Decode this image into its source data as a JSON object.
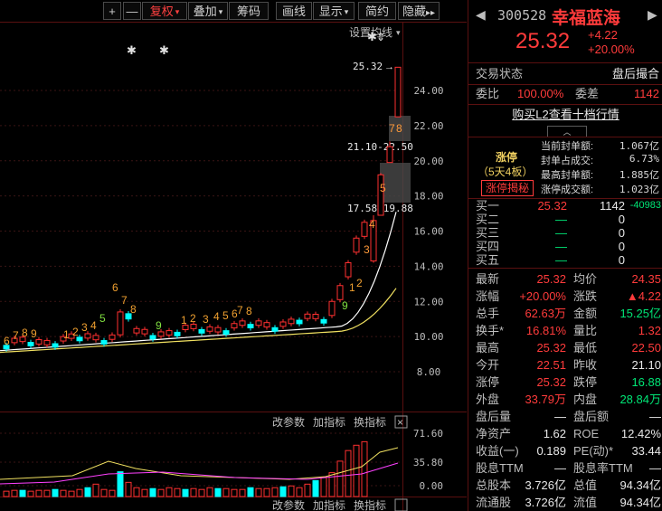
{
  "toolbar": {
    "plus": "+",
    "minus": "—",
    "buttons": [
      {
        "label": "复权",
        "active": true,
        "caret": true
      },
      {
        "label": "叠加",
        "active": false,
        "caret": true
      },
      {
        "label": "筹码",
        "active": false,
        "caret": false
      },
      {
        "label": "画线",
        "active": false,
        "caret": false
      },
      {
        "label": "显示",
        "active": false,
        "caret": true
      },
      {
        "label": "简约",
        "active": false,
        "caret": false
      },
      {
        "label": "隐藏",
        "active": false,
        "caret": false
      }
    ],
    "expand_glyph": "▸▸"
  },
  "chart": {
    "ma_settings": "设置均线",
    "price_axis": [
      "24.00",
      "22.00",
      "20.00",
      "18.00",
      "16.00",
      "14.00",
      "12.00",
      "10.00",
      "8.00"
    ],
    "annotations": {
      "high": "25.32",
      "gap1": "21.10-22.50",
      "gap2": "17.58-19.88"
    },
    "nine_turn_top": [
      "6",
      "7",
      "8",
      "9",
      "1",
      "2",
      "3",
      "4",
      "5",
      "6",
      "7",
      "8",
      "9",
      "1",
      "2",
      "3",
      "4",
      "5",
      "6",
      "7",
      "8",
      "9",
      "1",
      "2",
      "3",
      "4",
      "5",
      "7",
      "8"
    ],
    "volume_axis": [
      "71.60",
      "35.80",
      "0.00"
    ],
    "sub_panel_actions": [
      "改参数",
      "加指标",
      "换指标"
    ],
    "close_icon": "×",
    "colors": {
      "up": "#ff3030",
      "down": "#00ffff",
      "ma_white": "#ffffff",
      "ma_yellow": "#f0e060",
      "ma_pink": "#ff40ff"
    }
  },
  "quote": {
    "code": "300528",
    "name": "幸福蓝海",
    "price": "25.32",
    "change": "+4.22",
    "change_pct": "+20.00%",
    "trade_status_label": "交易状态",
    "trade_status_value": "盘后撮合",
    "weibi_label": "委比",
    "weibi_value": "100.00%",
    "weicha_label": "委差",
    "weicha_value": "1142",
    "l2_link": "购买L2查看十档行情",
    "limit_up": {
      "title": "涨停",
      "streak": "（5天4板）",
      "reveal_button": "涨停揭秘",
      "stats": [
        {
          "label": "当前封单额:",
          "value": "1.067亿"
        },
        {
          "label": "封单占成交:",
          "value": "6.73%"
        },
        {
          "label": "最高封单额:",
          "value": "1.885亿"
        },
        {
          "label": "涨停成交额:",
          "value": "1.023亿"
        }
      ]
    },
    "order_book": [
      {
        "label": "买一",
        "price": "25.32",
        "volume": "1142",
        "change": "-40983"
      },
      {
        "label": "买二",
        "price": "—",
        "volume": "0",
        "change": ""
      },
      {
        "label": "买三",
        "price": "—",
        "volume": "0",
        "change": ""
      },
      {
        "label": "买四",
        "price": "—",
        "volume": "0",
        "change": ""
      },
      {
        "label": "买五",
        "price": "—",
        "volume": "0",
        "change": ""
      }
    ],
    "stats": [
      [
        "最新",
        "25.32",
        "均价",
        "24.35"
      ],
      [
        "涨幅",
        "+20.00%",
        "涨跌",
        "▲4.22"
      ],
      [
        "总手",
        "62.63万",
        "金额",
        "15.25亿"
      ],
      [
        "换手*",
        "16.81%",
        "量比",
        "1.32"
      ],
      [
        "最高",
        "25.32",
        "最低",
        "22.50"
      ],
      [
        "今开",
        "22.51",
        "昨收",
        "21.10"
      ],
      [
        "涨停",
        "25.32",
        "跌停",
        "16.88"
      ],
      [
        "外盘",
        "33.79万",
        "内盘",
        "28.84万"
      ],
      [
        "盘后量",
        "—",
        "盘后额",
        "—"
      ],
      [
        "净资产",
        "1.62",
        "ROE",
        "12.42%"
      ],
      [
        "收益(一)",
        "0.189",
        "PE(动)*",
        "33.44"
      ],
      [
        "股息TTM",
        "—",
        "股息率TTM",
        "—"
      ],
      [
        "总股本",
        "3.726亿",
        "总值",
        "94.34亿"
      ],
      [
        "流通股",
        "3.726亿",
        "流值",
        "94.34亿"
      ]
    ]
  }
}
